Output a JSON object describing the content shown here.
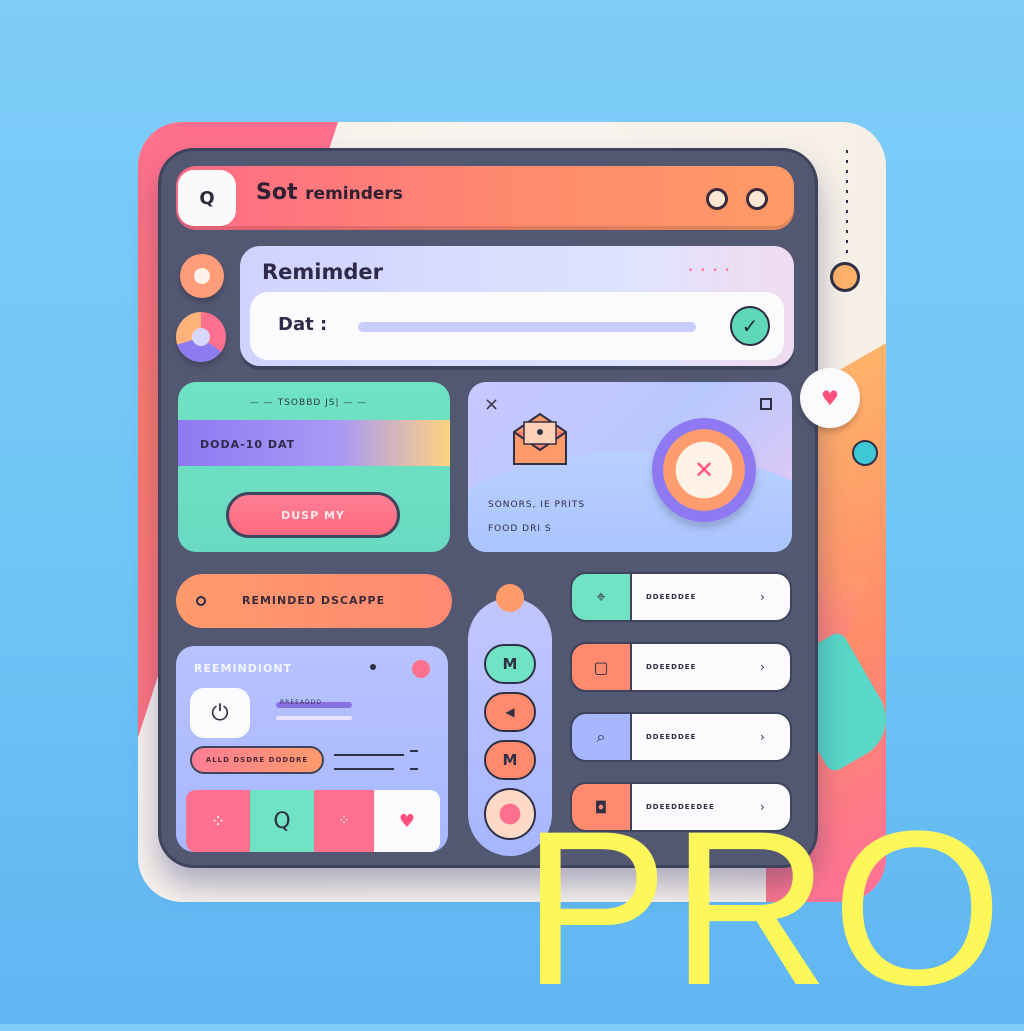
{
  "search": {
    "icon": "search-icon",
    "title_bold": "Sot",
    "title_rest": "reminders"
  },
  "reminder": {
    "title": "Remimder",
    "header_dots": "• • • •",
    "date_label": "Dat :",
    "check_icon": "check-icon"
  },
  "green_card": {
    "header": "— — TSOBBD JS| — —",
    "date_text": "DODA-10 DAT",
    "button_label": "DUSP MY"
  },
  "email_card": {
    "close_glyph": "×",
    "line1": "SONORS, IE PRITS",
    "line2": "FOOD DRI S"
  },
  "orange_bar": {
    "label": "REMINDED DSCAPPE"
  },
  "reminder_panel": {
    "title": "REEMINDIONT",
    "clock_icon": "power-icon",
    "line_label": "RREEADDO",
    "pill_label": "ALLD DSDRE DODDRE"
  },
  "tabs": [
    {
      "glyph": "⁘",
      "icon": "dots-icon"
    },
    {
      "glyph": "Q",
      "icon": "search-icon"
    },
    {
      "glyph": "⁘",
      "icon": "grid-icon"
    },
    {
      "glyph": "♥",
      "icon": "heart-icon"
    }
  ],
  "vertical_buttons": [
    {
      "label": "M"
    },
    {
      "label": "◀"
    },
    {
      "label": "M"
    },
    {
      "label": ""
    }
  ],
  "list": [
    {
      "icon_glyph": "⌖",
      "text": "DDEEDDEE"
    },
    {
      "icon_glyph": "▢",
      "text": "DDEEDDEE"
    },
    {
      "icon_glyph": "⌕",
      "text": "DDEEDDEE"
    },
    {
      "icon_glyph": "◘",
      "text": "DDEEDDEEDEE"
    }
  ],
  "list_arrow": "›",
  "side": {
    "heart": "♥"
  },
  "watermark": "PRO"
}
